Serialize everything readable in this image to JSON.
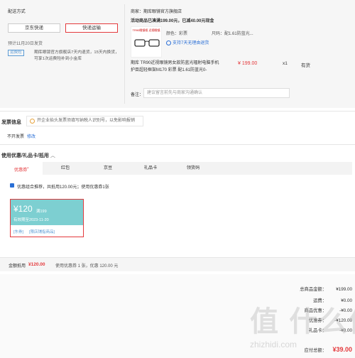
{
  "shipping": {
    "title": "配送方式",
    "options": [
      "京东快递",
      "快递运输"
    ],
    "selected_index": 1,
    "date_text": "预计11月20日发货",
    "service_tag": "运费险",
    "service_text": "期库眼镜官方旗舰店7天内退货，15天内换货，可享1次运费险补到小金库"
  },
  "shop": {
    "merchant": "商家：期库眼镜官方旗舰店",
    "promo": "活动商品已凑满199.00元，已减40.00元现金",
    "product_badge": "TR90眼镜框 近视眼镜",
    "color_label": "颜色：",
    "color_value": "彩票",
    "size_label": "尺码：",
    "size_value": "配1.61防蓝光...",
    "return_note": "支持7天无理由退货",
    "product_name": "期库 TR90近视眼镜男女款防蓝光辐射电脑手机护目超轻框架M170 彩票 配1.61防蓝光0-",
    "price": "¥ 199.00",
    "qty": "x1",
    "stock": "有货",
    "remark_label": "备注：",
    "remark_placeholder": "建议留言前先与商家沟通确认"
  },
  "invoice": {
    "title": "发票信息",
    "hint": "开企业抬头发票须填写纳税人识别号，以免影响报销",
    "value": "不开发票",
    "edit": "修改"
  },
  "discount": {
    "title": "使用优惠/礼品卡/抵用",
    "tabs": [
      "优惠券",
      "红包",
      "京豆",
      "礼品卡",
      "领货码"
    ],
    "active_tab": 0,
    "active_dot": "•",
    "auto_text": "优惠组合推荐，共抵用120.00元；使用优惠券1张",
    "coupon": {
      "amount": "¥120",
      "condition": "满199",
      "expire": "有效期至2023-11-20",
      "tag1": "[东券]",
      "tag2": "[限店铺指商品]"
    },
    "summary_label": "金额抵用",
    "summary_amount": "¥120.00",
    "summary_desc": "使用优惠券 1 张，优惠 120.00 元"
  },
  "totals": {
    "rows": [
      {
        "label": "总商品金额：",
        "value": "¥199.00"
      },
      {
        "label": "运费：",
        "value": "¥0.00"
      },
      {
        "label": "商品优惠：",
        "value": "-¥0.00"
      },
      {
        "label": "优惠券：",
        "value": "-¥120.00"
      },
      {
        "label": "礼品卡：",
        "value": "-¥0.00"
      }
    ],
    "pay_label": "应付总额：",
    "pay_value": "¥39.00"
  },
  "watermark": "值 什么值得买",
  "watermark_url": "zhizhidi.com",
  "colors": {
    "accent": "#e4393c",
    "teal": "#7dcfd1",
    "link": "#5b9bd5"
  }
}
